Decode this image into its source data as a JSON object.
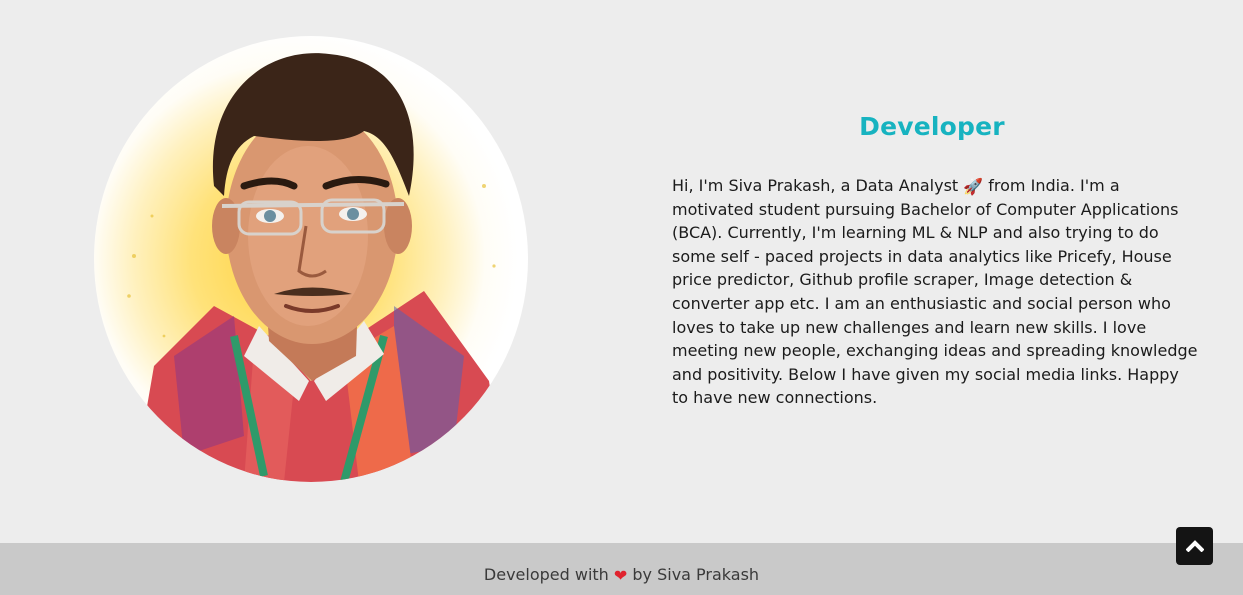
{
  "about": {
    "title": "Developer",
    "bio_part1": "Hi, I'm Siva Prakash, a Data Analyst ",
    "rocket_emoji": "🚀",
    "bio_part2": " from India. I'm a motivated student pursuing Bachelor of Computer Applications (BCA). Currently, I'm learning ML & NLP and also trying to do some self - paced projects in data analytics like Pricefy, House price predictor, Github profile scraper, Image detection & converter app etc. I am an enthusiastic and social person who loves to take up new challenges and learn new skills. I love meeting new people, exchanging ideas and spreading knowledge and positivity. Below I have given my social media links. Happy to have new connections."
  },
  "footer": {
    "text_before": "Developed with ",
    "heart": "❤",
    "text_after": " by Siva Prakash"
  },
  "icons": {
    "back_to_top": "chevron-up-icon",
    "rocket": "rocket-icon",
    "heart": "heart-icon"
  },
  "colors": {
    "accent": "#17b3c0",
    "background": "#ededed",
    "footer_bg": "#c9c9c9",
    "back_to_top_bg": "#141414",
    "heart": "#e0232e"
  }
}
